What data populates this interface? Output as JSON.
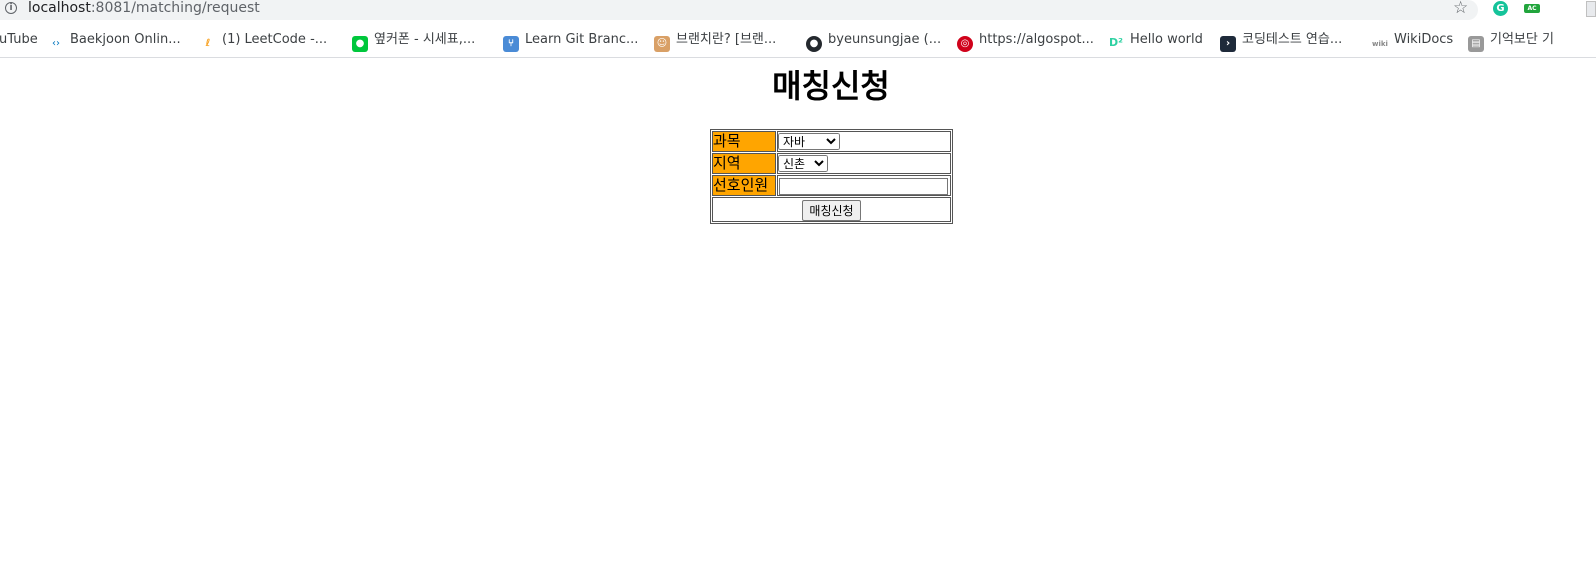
{
  "browser": {
    "url_host": "localhost",
    "url_rest": ":8081/matching/request",
    "info_glyph": "i",
    "star_glyph": "☆",
    "ext_grammarly": "G",
    "ext_ac": "AC",
    "bookmarks": [
      {
        "label": "uTube",
        "icon": "youtube-icon",
        "color": "#ff0000"
      },
      {
        "label": "Baekjoon Onlin...",
        "icon": "code-brackets-icon",
        "color": "#0076c0"
      },
      {
        "label": "(1) LeetCode -...",
        "icon": "leetcode-icon",
        "color": "#f89f1b"
      },
      {
        "label": "옆커폰 - 시세표,...",
        "icon": "green-chat-icon",
        "color": "#00c73c"
      },
      {
        "label": "Learn Git Branc...",
        "icon": "git-branch-icon",
        "color": "#4a8bd6"
      },
      {
        "label": "브랜치란? [브랜...",
        "icon": "person-icon",
        "color": "#d9a066"
      },
      {
        "label": "byeunsungjae (...",
        "icon": "github-icon",
        "color": "#24292e"
      },
      {
        "label": "https://algospot...",
        "icon": "target-icon",
        "color": "#d0021b"
      },
      {
        "label": "Hello world",
        "icon": "d2-icon",
        "color": "#2ed1a2"
      },
      {
        "label": "코딩테스트 연습...",
        "icon": "programmers-icon",
        "color": "#1e2a3a"
      },
      {
        "label": "WikiDocs",
        "icon": "wiki-icon",
        "color": "#888888"
      },
      {
        "label": "기억보단 기",
        "icon": "notebook-icon",
        "color": "#777777"
      }
    ]
  },
  "page": {
    "title": "매칭신청"
  },
  "form": {
    "subject_label": "과목",
    "subject_value": "자바",
    "region_label": "지역",
    "region_value": "신촌",
    "people_label": "선호인원",
    "people_value": "",
    "submit_label": "매칭신청"
  },
  "colors": {
    "label_bg": "#ffa500"
  }
}
